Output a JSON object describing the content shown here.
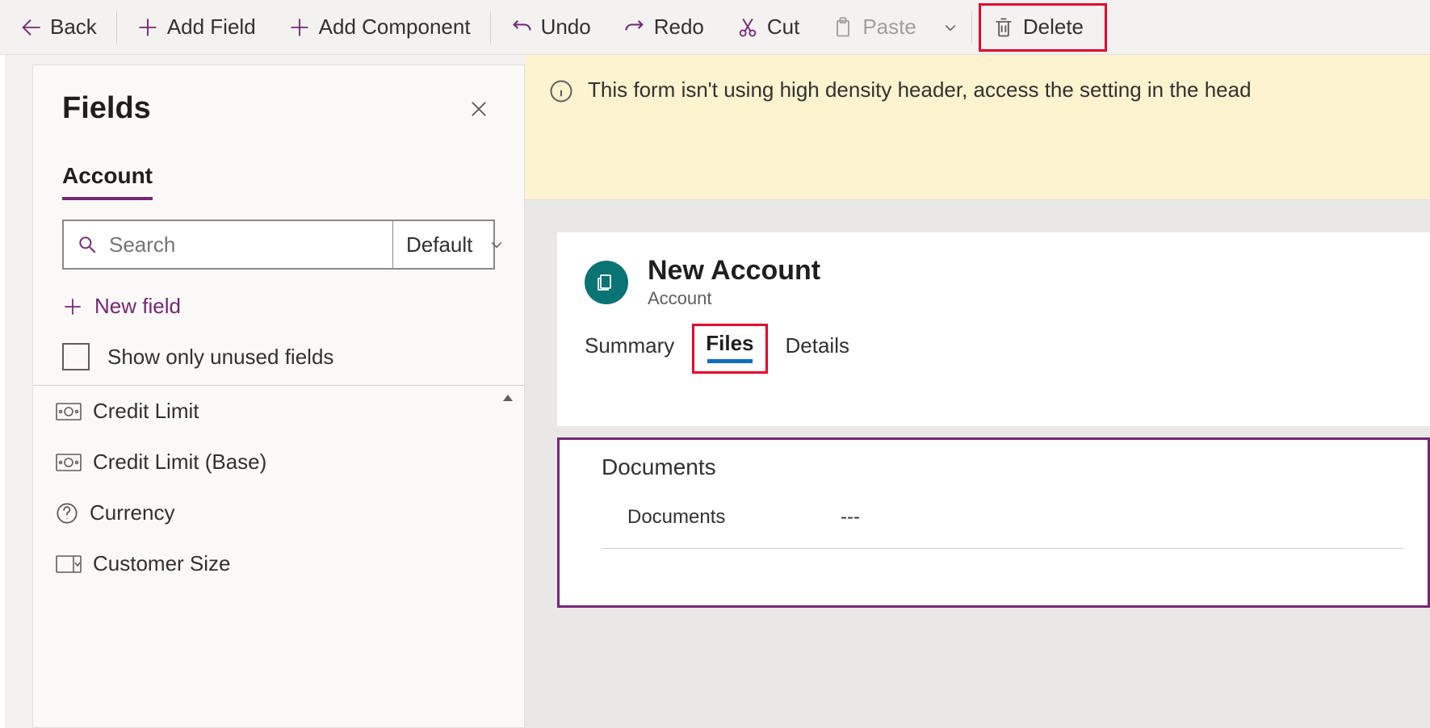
{
  "toolbar": {
    "back": "Back",
    "add_field": "Add Field",
    "add_component": "Add Component",
    "undo": "Undo",
    "redo": "Redo",
    "cut": "Cut",
    "paste": "Paste",
    "delete": "Delete"
  },
  "fields_panel": {
    "title": "Fields",
    "tab": "Account",
    "search_placeholder": "Search",
    "search_mode": "Default",
    "new_field": "New field",
    "show_unused": "Show only unused fields",
    "items": [
      {
        "label": "Credit Limit",
        "icon": "money"
      },
      {
        "label": "Credit Limit (Base)",
        "icon": "money"
      },
      {
        "label": "Currency",
        "icon": "help"
      },
      {
        "label": "Customer Size",
        "icon": "dropdown"
      }
    ]
  },
  "banner": {
    "text": "This form isn't using high density header, access the setting in the head"
  },
  "form": {
    "title": "New Account",
    "entity": "Account",
    "tabs": {
      "summary": "Summary",
      "files": "Files",
      "details": "Details"
    },
    "section": {
      "title": "Documents",
      "row_label": "Documents",
      "row_value": "---"
    }
  }
}
